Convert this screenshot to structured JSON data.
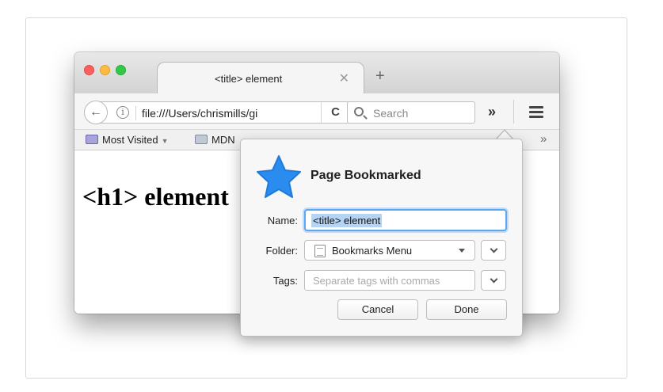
{
  "tab": {
    "title": "<title> element",
    "close_glyph": "✕",
    "new_tab_glyph": "+"
  },
  "toolbar": {
    "url": "file:///Users/chrismills/gi",
    "reload_glyph": "C",
    "search_placeholder": "Search",
    "overflow_glyph": "»",
    "info_glyph": "i",
    "back_glyph": "←"
  },
  "bookmarks_bar": {
    "items": [
      "Most Visited",
      "MDN"
    ],
    "overflow_glyph": "»"
  },
  "page": {
    "heading": "<h1> element"
  },
  "panel": {
    "title": "Page Bookmarked",
    "name_label": "Name:",
    "name_value": "<title> element",
    "folder_label": "Folder:",
    "folder_value": "Bookmarks Menu",
    "tags_label": "Tags:",
    "tags_placeholder": "Separate tags with commas",
    "cancel_label": "Cancel",
    "done_label": "Done"
  },
  "colors": {
    "star": "#2a8cef",
    "focus_ring": "#5ea5f2",
    "selection": "#b5d3f5",
    "close": "#fc605c",
    "minimize": "#fdbc40",
    "zoom": "#34c84a"
  },
  "icons": [
    "back-arrow-icon",
    "info-icon",
    "reload-icon",
    "search-icon",
    "overflow-chevron-icon",
    "menu-icon",
    "folder-icon",
    "star-icon",
    "document-icon",
    "chevron-down-icon"
  ]
}
